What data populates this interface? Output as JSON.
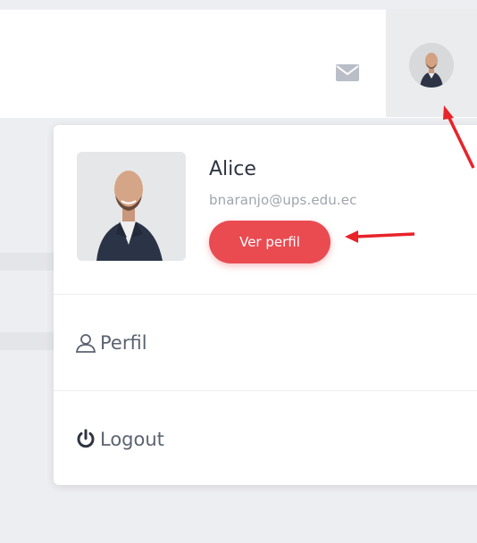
{
  "header": {
    "mail_icon": "envelope-icon",
    "avatar_icon": "user-avatar"
  },
  "dropdown": {
    "user": {
      "name": "Alice",
      "email": "bnaranjo@ups.edu.ec"
    },
    "view_profile_label": "Ver perfil",
    "items": [
      {
        "label": "Perfil",
        "icon": "user-outline-icon"
      },
      {
        "label": "Logout",
        "icon": "power-icon"
      }
    ]
  },
  "colors": {
    "accent": "#e94b51",
    "annotation": "#e8232a"
  }
}
